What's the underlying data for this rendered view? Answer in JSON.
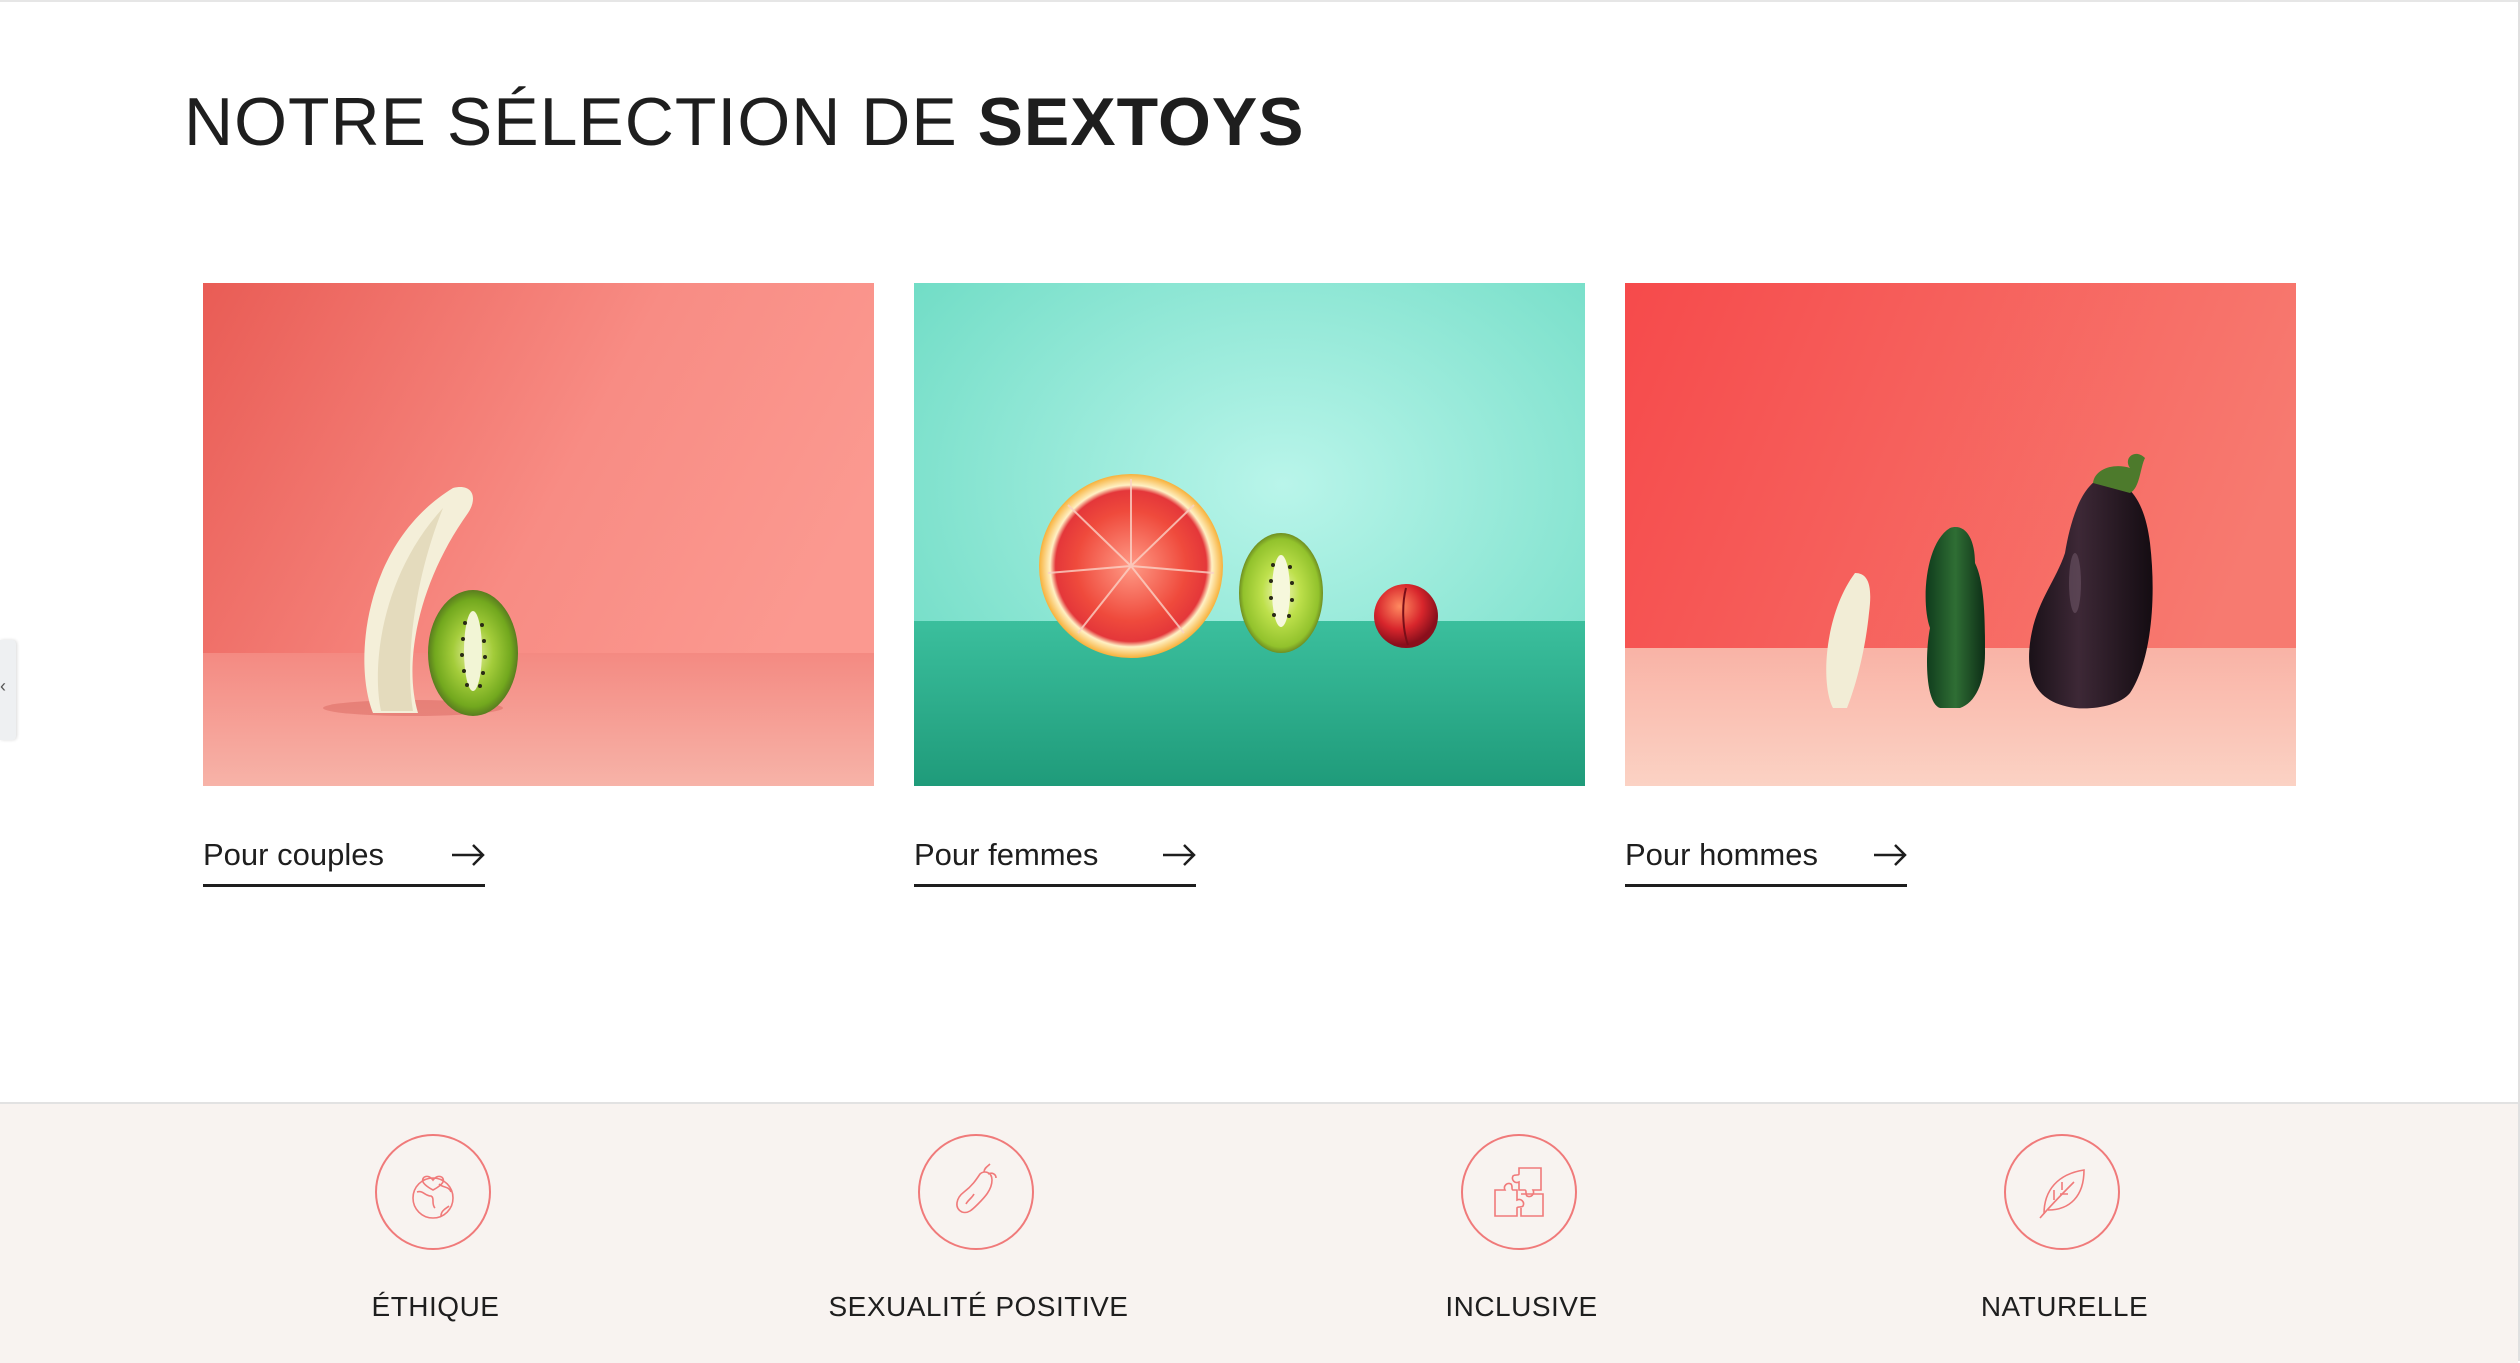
{
  "section": {
    "title_light": "NOTRE SÉLECTION DE ",
    "title_bold": "SEXTOYS"
  },
  "cards": [
    {
      "label": "Pour couples",
      "image": "banana-and-kiwi-on-coral",
      "bg_color": "#f4807a"
    },
    {
      "label": "Pour femmes",
      "image": "grapefruit-kiwi-nectarine-on-turquoise",
      "bg_color": "#8fe3d3"
    },
    {
      "label": "Pour hommes",
      "image": "banana-cucumber-eggplant-on-red",
      "bg_color": "#f5645f"
    }
  ],
  "features": [
    {
      "label": "ÉTHIQUE",
      "icon": "earth-heart-icon"
    },
    {
      "label": "SEXUALITÉ POSITIVE",
      "icon": "eggplant-icon"
    },
    {
      "label": "INCLUSIVE",
      "icon": "puzzle-icon"
    },
    {
      "label": "NATURELLE",
      "icon": "leaf-icon"
    }
  ],
  "colors": {
    "accent": "#f07a7a",
    "text": "#1e1e1e",
    "features_bg": "#f8f3f0"
  },
  "side_tab": {
    "glyph": "‹"
  }
}
